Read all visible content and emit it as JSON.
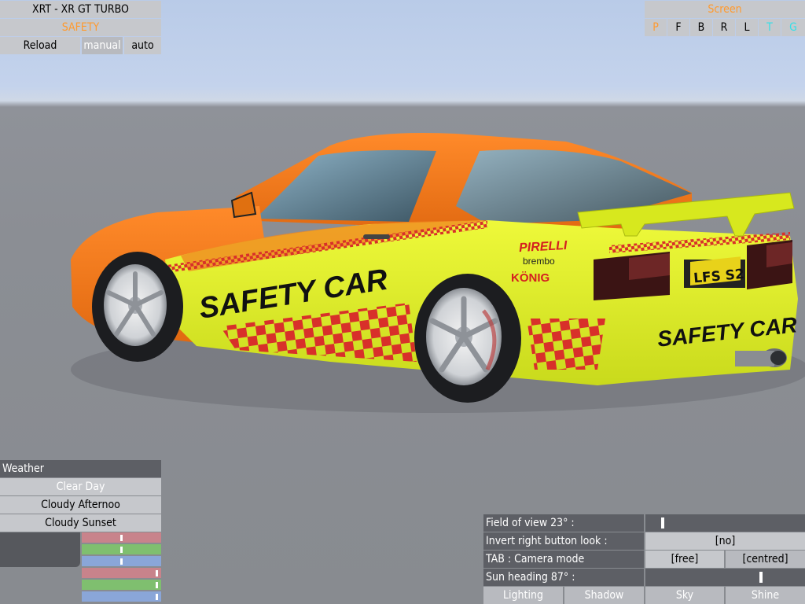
{
  "car": {
    "model": "XRT - XR GT TURBO",
    "skin": "SAFETY",
    "reload_label": "Reload",
    "manual_label": "manual",
    "auto_label": "auto",
    "livery_text_side": "SAFETY CAR",
    "livery_text_rear": "SAFETY CAR",
    "sponsor_1": "PIRELLI",
    "sponsor_2": "brembo",
    "sponsor_3": "KÖNIG",
    "plate": "LFS S2"
  },
  "screen": {
    "title": "Screen",
    "buttons": [
      "P",
      "F",
      "B",
      "R",
      "L",
      "T",
      "G"
    ],
    "active": [
      "P",
      "T",
      "G"
    ]
  },
  "weather": {
    "title": "Weather",
    "options": [
      "Clear Day",
      "Cloudy Afternoo",
      "Cloudy Sunset"
    ],
    "selected": "Clear Day",
    "color_sliders": [
      {
        "channel": "red",
        "color": "#c8838b",
        "level": 0.5
      },
      {
        "channel": "green",
        "color": "#7fbf6f",
        "level": 0.5
      },
      {
        "channel": "blue",
        "color": "#8aa6d8",
        "level": 0.5
      },
      {
        "channel": "red",
        "color": "#c8838b",
        "level": 0.97
      },
      {
        "channel": "green",
        "color": "#7fbf6f",
        "level": 0.97
      },
      {
        "channel": "blue",
        "color": "#8aa6d8",
        "level": 0.97
      }
    ]
  },
  "view": {
    "fov_label": "Field of view 23° :",
    "fov_level": 0.1,
    "invert_label": "Invert right button look :",
    "invert_value": "[no]",
    "camera_label": "TAB : Camera mode",
    "camera_free": "[free]",
    "camera_centred": "[centred]",
    "sun_label": "Sun heading 87° :",
    "sun_level": 0.73,
    "tabs": [
      "Lighting",
      "Shadow",
      "Sky",
      "Shine"
    ]
  },
  "colors": {
    "orange_text": "#ff9a2e",
    "car_orange": "#f07a18",
    "car_yellow": "#dced24",
    "check_red": "#d8302a"
  }
}
